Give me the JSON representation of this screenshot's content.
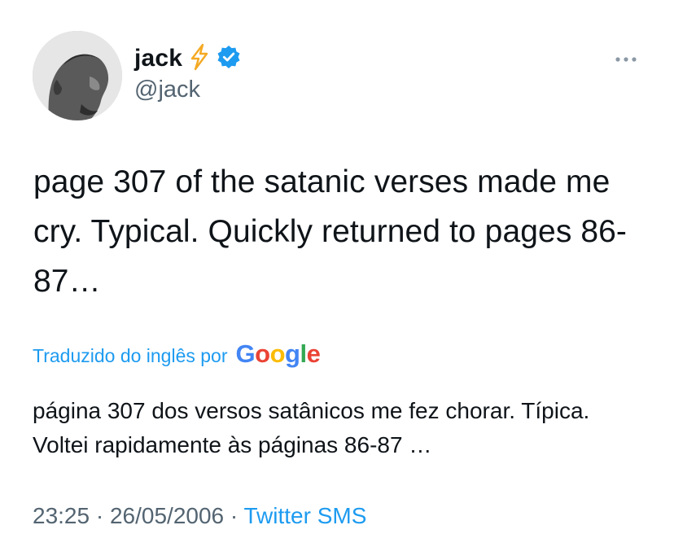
{
  "author": {
    "display_name": "jack",
    "handle": "@jack",
    "emoji": "⚡"
  },
  "tweet": {
    "text": "page 307 of the satanic verses made me cry. Typical. Quickly returned to pages 86-87…"
  },
  "translation": {
    "label": "Traduzido do inglês por",
    "provider": "Google",
    "text": "página 307 dos versos satânicos me fez chorar. Típica. Voltei rapidamente às páginas 86-87 …"
  },
  "meta": {
    "time": "23:25",
    "separator": "·",
    "date": "26/05/2006",
    "source": "Twitter SMS"
  },
  "icons": {
    "verified": "verified-badge-icon",
    "bolt": "lightning-bolt-icon",
    "more": "more-options-icon"
  },
  "colors": {
    "accent": "#1d9bf0",
    "secondary_text": "#536471",
    "primary_text": "#0f1419",
    "bolt": "#f4a923"
  }
}
